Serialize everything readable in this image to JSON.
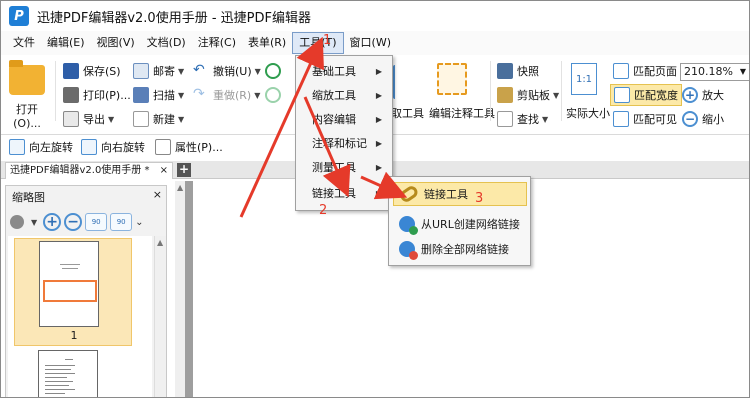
{
  "app": {
    "title": "迅捷PDF编辑器v2.0使用手册 - 迅捷PDF编辑器",
    "logo_letter": "P"
  },
  "menubar": [
    {
      "label": "文件"
    },
    {
      "label": "编辑(E)"
    },
    {
      "label": "视图(V)"
    },
    {
      "label": "文档(D)"
    },
    {
      "label": "注释(C)"
    },
    {
      "label": "表单(R)"
    },
    {
      "label": "工具(T)"
    },
    {
      "label": "窗口(W)"
    }
  ],
  "ribbon": {
    "open": "打开(O)...",
    "save": "保存(S)",
    "print": "打印(P)...",
    "export": "导出",
    "email": "邮寄",
    "scan": "扫描",
    "new": "新建",
    "undo": "撤销(U)",
    "redo": "重做(R)",
    "quick_photo": "快照",
    "clipboard": "剪贴板",
    "find": "查找",
    "edit_tool_suffix": "取工具",
    "edit_annot_tool": "编辑注释工具",
    "actual_size": "实际大小",
    "actual_size_icon": "1:1",
    "fit_page": "匹配页面",
    "fit_width": "匹配宽度",
    "fit_visible": "匹配可见",
    "zoom_value": "210.18%",
    "zoom_in": "放大",
    "zoom_out": "缩小"
  },
  "toolbar2": {
    "rotate_left": "向左旋转",
    "rotate_right": "向右旋转",
    "properties": "属性(P)..."
  },
  "tabs": {
    "doc_tab": "迅捷PDF编辑器v2.0使用手册 *",
    "close": "×",
    "new": "+"
  },
  "thumbnail_panel": {
    "title": "缩略图",
    "close": "×",
    "page_number": "1",
    "rot_labels": [
      "90",
      "90"
    ]
  },
  "tools_menu": {
    "items": [
      {
        "label": "基础工具"
      },
      {
        "label": "缩放工具"
      },
      {
        "label": "内容编辑"
      },
      {
        "label": "注释和标记"
      },
      {
        "label": "测量工具"
      },
      {
        "label": "链接工具"
      }
    ]
  },
  "link_submenu": {
    "items": [
      {
        "label": "链接工具"
      },
      {
        "label": "从URL创建网络链接"
      },
      {
        "label": "删除全部网络链接"
      }
    ]
  },
  "annotations": {
    "step1": "1",
    "step2": "2",
    "step3": "3",
    "arrow_color": "#e53a2a"
  },
  "colors": {
    "accent_blue": "#1f7fd6",
    "selection_yellow": "#fce9a8",
    "folder": "#f2b233"
  }
}
